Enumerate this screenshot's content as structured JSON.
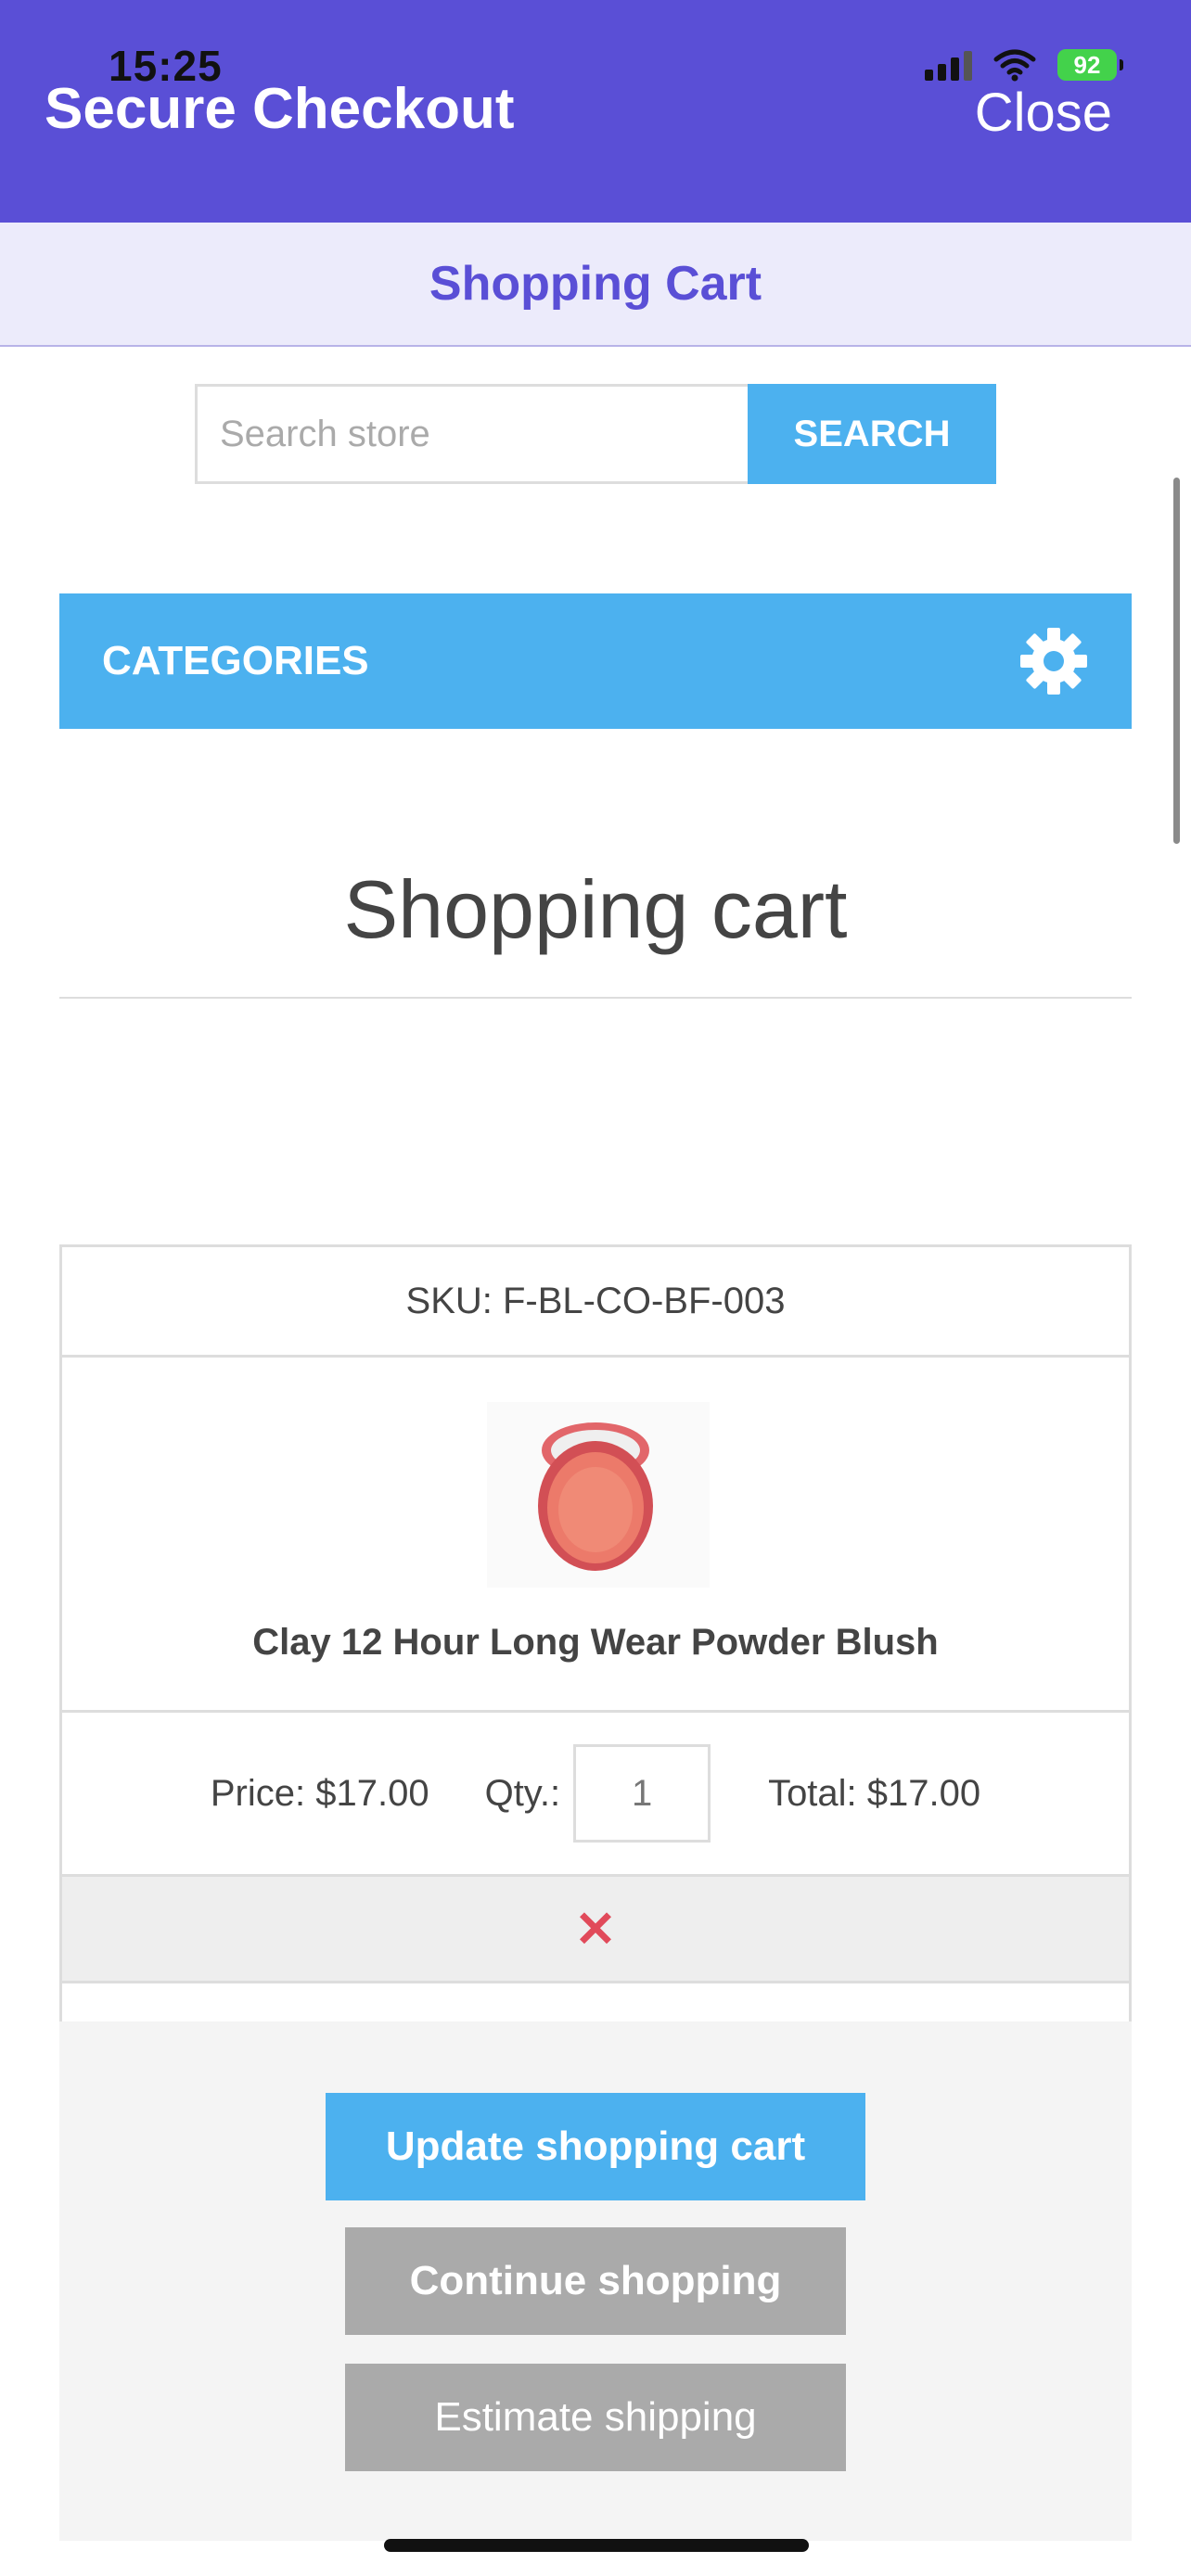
{
  "status_bar": {
    "time": "15:25",
    "battery": "92"
  },
  "header": {
    "title": "Secure Checkout",
    "close_label": "Close"
  },
  "subheader": {
    "title": "Shopping Cart"
  },
  "search": {
    "placeholder": "Search store",
    "button_label": "SEARCH"
  },
  "categories": {
    "label": "CATEGORIES"
  },
  "page": {
    "title": "Shopping cart"
  },
  "cart_item": {
    "sku": "SKU: F-BL-CO-BF-003",
    "product_name": "Clay 12 Hour Long Wear Powder Blush",
    "price": "Price: $17.00",
    "qty_label": "Qty.:",
    "qty_value": "1",
    "total": "Total: $17.00",
    "remove_symbol": "✕"
  },
  "buttons": {
    "update": "Update shopping cart",
    "continue": "Continue shopping",
    "estimate": "Estimate shipping"
  },
  "colors": {
    "header_bg": "#5a4fd6",
    "accent": "#4cb1ef",
    "remove": "#e14a5a",
    "secondary_button": "#aaaaaa"
  }
}
